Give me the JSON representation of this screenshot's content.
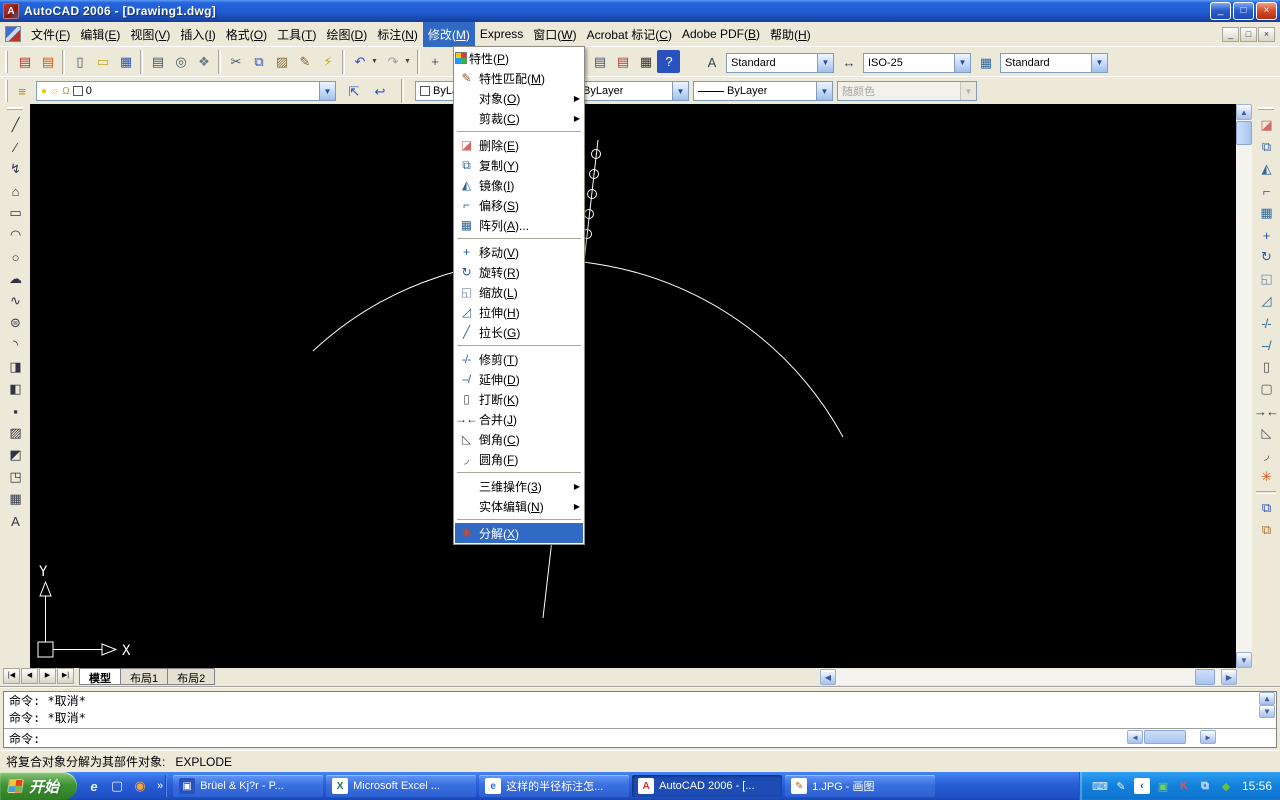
{
  "window": {
    "title": "AutoCAD 2006 - [Drawing1.dwg]",
    "controls": {
      "minimize": "_",
      "restore": "□",
      "close": "×"
    }
  },
  "menubar": {
    "items": [
      {
        "label": "文件",
        "key": "F"
      },
      {
        "label": "编辑",
        "key": "E"
      },
      {
        "label": "视图",
        "key": "V"
      },
      {
        "label": "插入",
        "key": "I"
      },
      {
        "label": "格式",
        "key": "O"
      },
      {
        "label": "工具",
        "key": "T"
      },
      {
        "label": "绘图",
        "key": "D"
      },
      {
        "label": "标注",
        "key": "N"
      },
      {
        "label": "修改",
        "key": "M",
        "active": true
      },
      {
        "label": "Express"
      },
      {
        "label": "窗口",
        "key": "W"
      },
      {
        "label": "Acrobat 标记",
        "key": "C"
      },
      {
        "label": "Adobe PDF",
        "key": "B"
      },
      {
        "label": "帮助",
        "key": "H"
      }
    ],
    "mdi": {
      "minimize": "_",
      "restore": "□",
      "close": "×"
    }
  },
  "modify_menu": {
    "items": [
      {
        "label": "特性",
        "key": "P",
        "icon": "properties-icon",
        "glyph": ""
      },
      {
        "label": "特性匹配",
        "key": "M",
        "icon": "matchprop-icon",
        "glyph": "✎",
        "color": "#8a5a2b"
      },
      {
        "label": "对象",
        "key": "O",
        "submenu": true
      },
      {
        "label": "剪裁",
        "key": "C",
        "submenu": true
      },
      {
        "type": "sep"
      },
      {
        "label": "删除",
        "key": "E",
        "icon": "erase-icon",
        "glyph": "◪",
        "color": "#d06a6a"
      },
      {
        "label": "复制",
        "key": "Y",
        "icon": "copy-icon",
        "glyph": "⧉",
        "color": "#336699"
      },
      {
        "label": "镜像",
        "key": "I",
        "icon": "mirror-icon",
        "glyph": "◭",
        "color": "#336699"
      },
      {
        "label": "偏移",
        "key": "S",
        "icon": "offset-icon",
        "glyph": "⌐",
        "color": "#336699"
      },
      {
        "label": "阵列",
        "key": "A",
        "ellipsis": true,
        "icon": "array-icon",
        "glyph": "▦",
        "color": "#336699"
      },
      {
        "type": "sep"
      },
      {
        "label": "移动",
        "key": "V",
        "icon": "move-icon",
        "glyph": "+",
        "color": "#2a52be"
      },
      {
        "label": "旋转",
        "key": "R",
        "icon": "rotate-icon",
        "glyph": "↻",
        "color": "#2a52be"
      },
      {
        "label": "缩放",
        "key": "L",
        "icon": "scale-icon",
        "glyph": "◱",
        "color": "#7788aa"
      },
      {
        "label": "拉伸",
        "key": "H",
        "icon": "stretch-icon",
        "glyph": "◿",
        "color": "#336699"
      },
      {
        "label": "拉长",
        "key": "G",
        "icon": "lengthen-icon",
        "glyph": "╱",
        "color": "#336699"
      },
      {
        "type": "sep"
      },
      {
        "label": "修剪",
        "key": "T",
        "icon": "trim-icon",
        "glyph": "-/-",
        "color": "#336699"
      },
      {
        "label": "延伸",
        "key": "D",
        "icon": "extend-icon",
        "glyph": "--/",
        "color": "#336699"
      },
      {
        "label": "打断",
        "key": "K",
        "icon": "break-icon",
        "glyph": "▯",
        "color": "#555555"
      },
      {
        "label": "合并",
        "key": "J",
        "icon": "join-icon",
        "glyph": "→←",
        "color": "#333333"
      },
      {
        "label": "倒角",
        "key": "C",
        "icon": "chamfer-icon",
        "glyph": "◺",
        "color": "#555555"
      },
      {
        "label": "圆角",
        "key": "F",
        "icon": "fillet-icon",
        "glyph": "◞",
        "color": "#555555"
      },
      {
        "type": "sep"
      },
      {
        "label": "三维操作",
        "key": "3",
        "submenu": true
      },
      {
        "label": "实体编辑",
        "key": "N",
        "submenu": true
      },
      {
        "type": "sep"
      },
      {
        "label": "分解",
        "key": "X",
        "icon": "explode-icon",
        "glyph": "✳",
        "color": "#e64a19",
        "highlighted": true
      }
    ]
  },
  "toolbars": {
    "standard_groups": [
      [
        {
          "name": "pdf-convert-icon",
          "glyph": "▤",
          "color": "#c62828"
        },
        {
          "name": "pdf-comment-icon",
          "glyph": "▤",
          "color": "#e65100"
        }
      ],
      [
        {
          "name": "qnew-icon",
          "glyph": "▯",
          "color": "#445566"
        },
        {
          "name": "open-icon",
          "glyph": "▭",
          "color": "#c8a415"
        },
        {
          "name": "save-icon",
          "glyph": "▦",
          "color": "#2a52be"
        }
      ],
      [
        {
          "name": "plot-icon",
          "glyph": "▤",
          "color": "#445566"
        },
        {
          "name": "plot-preview-icon",
          "glyph": "◎",
          "color": "#445566"
        },
        {
          "name": "publish-icon",
          "glyph": "❖",
          "color": "#667788"
        }
      ],
      [
        {
          "name": "cut-icon",
          "glyph": "✂",
          "color": "#445566"
        },
        {
          "name": "copy-icon",
          "glyph": "⧉",
          "color": "#2a52be"
        },
        {
          "name": "paste-icon",
          "glyph": "▨",
          "color": "#8a6d3b"
        },
        {
          "name": "matchprop-icon",
          "glyph": "✎",
          "color": "#8a5a2b"
        },
        {
          "name": "block-editor-icon",
          "glyph": "⚡",
          "color": "#c8a415"
        }
      ],
      [
        {
          "name": "undo-icon",
          "glyph": "↶",
          "color": "#2a52be",
          "dropdown": true
        },
        {
          "name": "redo-icon",
          "glyph": "↷",
          "color": "#9a9a9a",
          "dropdown": true,
          "disabled": true
        }
      ],
      [
        {
          "name": "pan-icon",
          "glyph": "+",
          "color": "#445566"
        },
        {
          "name": "zoom-realtime-icon",
          "glyph": "⊕",
          "color": "#445566"
        }
      ]
    ],
    "standard_right": [
      {
        "name": "sheetset-manager-icon",
        "glyph": "▤",
        "color": "#445577"
      },
      {
        "name": "markup-manager-icon",
        "glyph": "▤",
        "color": "#bb3333"
      },
      {
        "name": "quickcalc-icon",
        "glyph": "▦",
        "color": "#333333"
      },
      {
        "name": "help-icon",
        "glyph": "?",
        "color": "#ffffff",
        "bg": "#2a52be"
      }
    ],
    "styles": {
      "text_style": "Standard",
      "dim_style": "ISO-25",
      "table_style": "Standard"
    },
    "style_icons": [
      {
        "name": "text-style-icon",
        "glyph": "A",
        "color": "#334455"
      },
      {
        "name": "dim-style-icon",
        "glyph": "↔",
        "color": "#334455"
      },
      {
        "name": "table-style-icon",
        "glyph": "▦",
        "color": "#336699"
      }
    ],
    "layers": {
      "current_layer": "0",
      "state_icons": [
        {
          "name": "layer-on-icon",
          "glyph": "●",
          "color": "#f5c400"
        },
        {
          "name": "layer-freeze-icon",
          "glyph": "☼",
          "color": "#e8b800"
        },
        {
          "name": "layer-lock-icon",
          "glyph": "Ω",
          "color": "#b09a4a"
        },
        {
          "name": "layer-color-icon",
          "glyph": "",
          "color": "#ffffff"
        }
      ],
      "toolbar_icons": [
        {
          "name": "layer-properties-icon",
          "glyph": "≡",
          "color": "#b8860b"
        },
        {
          "name": "make-object-layer-current-icon",
          "glyph": "⇱",
          "color": "#2a52be"
        },
        {
          "name": "layer-previous-icon",
          "glyph": "↩",
          "color": "#2a52be"
        }
      ]
    },
    "properties": {
      "color": "ByLayer",
      "linetype": "ByLayer",
      "lineweight": "ByLayer",
      "plot_style": "随颜色"
    },
    "draw": {
      "items": [
        {
          "name": "line-icon",
          "glyph": "╱"
        },
        {
          "name": "construction-line-icon",
          "glyph": "∕"
        },
        {
          "name": "polyline-icon",
          "glyph": "↯"
        },
        {
          "name": "polygon-icon",
          "glyph": "⌂"
        },
        {
          "name": "rectangle-icon",
          "glyph": "▭"
        },
        {
          "name": "arc-icon",
          "glyph": "◠"
        },
        {
          "name": "circle-icon",
          "glyph": "○"
        },
        {
          "name": "revcloud-icon",
          "glyph": "☁"
        },
        {
          "name": "spline-icon",
          "glyph": "∿"
        },
        {
          "name": "ellipse-icon",
          "glyph": "⊜"
        },
        {
          "name": "ellipse-arc-icon",
          "glyph": "◝"
        },
        {
          "name": "insert-block-icon",
          "glyph": "◨"
        },
        {
          "name": "make-block-icon",
          "glyph": "◧"
        },
        {
          "name": "point-icon",
          "glyph": "▪"
        },
        {
          "name": "hatch-icon",
          "glyph": "▨"
        },
        {
          "name": "gradient-icon",
          "glyph": "◩"
        },
        {
          "name": "region-icon",
          "glyph": "◳"
        },
        {
          "name": "table-icon",
          "glyph": "▦"
        },
        {
          "name": "mtext-icon",
          "glyph": "A"
        }
      ]
    },
    "modify": {
      "items": [
        {
          "name": "erase-icon",
          "glyph": "◪",
          "color": "#d06a6a"
        },
        {
          "name": "copy-icon",
          "glyph": "⧉",
          "color": "#336699"
        },
        {
          "name": "mirror-icon",
          "glyph": "◭",
          "color": "#336699"
        },
        {
          "name": "offset-icon",
          "glyph": "⌐",
          "color": "#336699"
        },
        {
          "name": "array-icon",
          "glyph": "▦",
          "color": "#336699"
        },
        {
          "name": "move-icon",
          "glyph": "+",
          "color": "#2a52be"
        },
        {
          "name": "rotate-icon",
          "glyph": "↻",
          "color": "#2a52be"
        },
        {
          "name": "scale-icon",
          "glyph": "◱",
          "color": "#7788aa"
        },
        {
          "name": "stretch-icon",
          "glyph": "◿",
          "color": "#336699"
        },
        {
          "name": "trim-icon",
          "glyph": "-/-",
          "color": "#336699"
        },
        {
          "name": "extend-icon",
          "glyph": "--/",
          "color": "#336699"
        },
        {
          "name": "break-at-point-icon",
          "glyph": "▯",
          "color": "#555555"
        },
        {
          "name": "break-icon",
          "glyph": "▢",
          "color": "#555555"
        },
        {
          "name": "join-icon",
          "glyph": "→←",
          "color": "#333333"
        },
        {
          "name": "chamfer-icon",
          "glyph": "◺",
          "color": "#555555"
        },
        {
          "name": "fillet-icon",
          "glyph": "◞",
          "color": "#555555"
        },
        {
          "name": "explode-icon",
          "glyph": "✳",
          "color": "#e64a19"
        }
      ]
    },
    "draw_order": {
      "items": [
        {
          "name": "draworder-front-icon",
          "glyph": "⧉",
          "color": "#2a52be"
        },
        {
          "name": "draworder-back-icon",
          "glyph": "⧉",
          "color": "#b36b24"
        }
      ]
    }
  },
  "scrollbars": {
    "up": "▲",
    "down": "▼",
    "left": "◀",
    "right": "▶"
  },
  "layout_tabs": {
    "nav": [
      "|◀",
      "◀",
      "▶",
      "▶|"
    ],
    "items": [
      {
        "label": "模型",
        "active": true
      },
      {
        "label": "布局1"
      },
      {
        "label": "布局2"
      }
    ]
  },
  "command": {
    "history": [
      "命令: *取消*",
      "命令: *取消*"
    ],
    "prompt": "命令:"
  },
  "statusbar": {
    "message": "将复合对象分解为其部件对象:   EXPLODE"
  },
  "drawing": {
    "ucs": {
      "x_label": "X",
      "y_label": "Y"
    }
  },
  "taskbar": {
    "start": "开始",
    "quick_launch": [
      {
        "name": "ie-icon",
        "glyph": "e",
        "color": "#eaf2ff"
      },
      {
        "name": "show-desktop-icon",
        "glyph": "▢",
        "color": "#dce9f8"
      },
      {
        "name": "media-app-icon",
        "glyph": "◉",
        "color": "#f3a43b"
      }
    ],
    "overflow": "»",
    "buttons": [
      {
        "label": "Brüel & Kj?r - P...",
        "icon": {
          "name": "bruel-window-icon",
          "glyph": "▣",
          "color": "#ffffff",
          "bg": "#2a52be"
        }
      },
      {
        "label": "Microsoft Excel ...",
        "icon": {
          "name": "excel-icon",
          "glyph": "X",
          "color": "#1e7145",
          "bg": "#ffffff"
        }
      },
      {
        "label": "这样的半径标注怎...",
        "icon": {
          "name": "ie-page-icon",
          "glyph": "e",
          "color": "#2a6fd6",
          "bg": "#ffffff"
        }
      },
      {
        "label": "AutoCAD 2006 - [...",
        "active": true,
        "icon": {
          "name": "autocad-icon",
          "glyph": "A",
          "color": "#c8372b",
          "bg": "#ffffff"
        }
      },
      {
        "label": "1.JPG - 画图",
        "icon": {
          "name": "paint-icon",
          "glyph": "✎",
          "color": "#b5651d",
          "bg": "#ffffff"
        }
      }
    ],
    "tray": {
      "icons": [
        {
          "name": "keyboard-icon",
          "glyph": "⌨",
          "color": "#eaf2ff"
        },
        {
          "name": "pen-input-icon",
          "glyph": "✎",
          "color": "#eaf2ff"
        },
        {
          "name": "collapse-chevron-icon",
          "glyph": "‹",
          "color": "#1a57c9",
          "bg": "#ffffff"
        },
        {
          "name": "agent-tray-icon",
          "glyph": "▣",
          "color": "#74d054"
        },
        {
          "name": "kaspersky-icon",
          "glyph": "K",
          "color": "#ff4545"
        },
        {
          "name": "network-tray-icon",
          "glyph": "⧉",
          "color": "#cfe0ff"
        },
        {
          "name": "update-shield-icon",
          "glyph": "◆",
          "color": "#67c23a"
        }
      ],
      "time": "15:56"
    }
  }
}
